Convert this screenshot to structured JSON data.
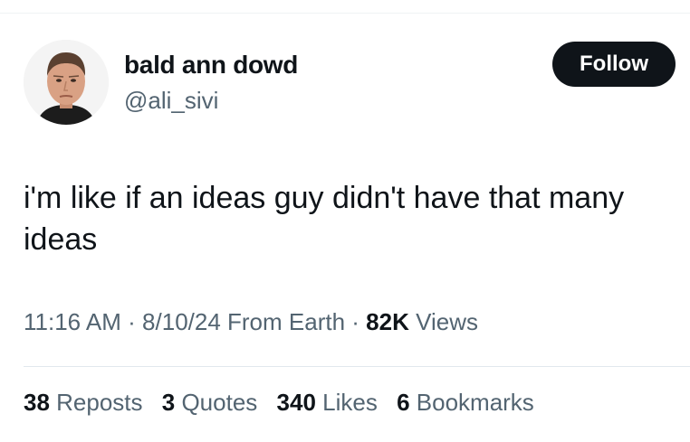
{
  "author": {
    "display_name": "bald ann dowd",
    "handle": "@ali_sivi",
    "avatar_icon": "person-avatar"
  },
  "follow_button": {
    "label": "Follow"
  },
  "tweet": {
    "text": "i'm like if an ideas guy didn't have that many ideas"
  },
  "meta": {
    "time": "11:16 AM",
    "separator1": " · ",
    "date": "8/10/24",
    "source": " From Earth",
    "separator2": " · ",
    "views_count": "82K",
    "views_label": " Views"
  },
  "stats": [
    {
      "count": "38",
      "label": " Reposts"
    },
    {
      "count": "3",
      "label": " Quotes"
    },
    {
      "count": "340",
      "label": " Likes"
    },
    {
      "count": "6",
      "label": " Bookmarks"
    }
  ],
  "colors": {
    "text_primary": "#0f1419",
    "text_secondary": "#536471",
    "button_bg": "#0f1419",
    "button_text": "#ffffff"
  }
}
